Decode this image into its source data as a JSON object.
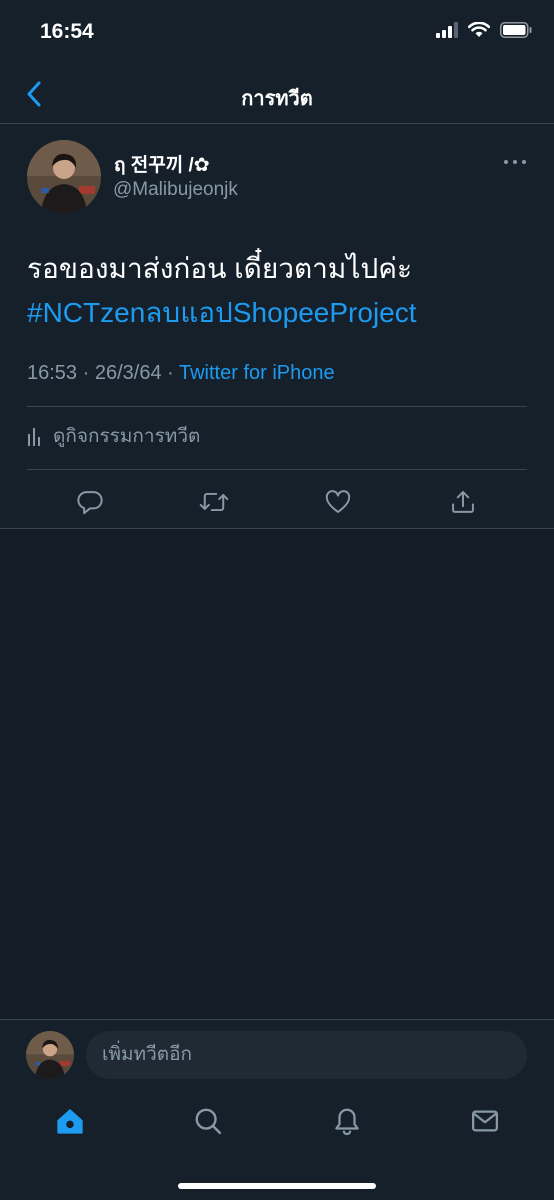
{
  "status_bar": {
    "time": "16:54"
  },
  "header": {
    "title": "การทวีต"
  },
  "tweet": {
    "display_name": "ฤ 전꾸끼 /✿",
    "handle": "@Malibujeonjk",
    "text": "รอของมาส่งก่อน เดี๋ยวตามไปค่ะ",
    "hashtag": "#NCTzenลบแอปShopeeProject",
    "time": "16:53",
    "date": "26/3/64",
    "source": "Twitter for iPhone",
    "activity_label": "ดูกิจกรรมการทวีต"
  },
  "reply": {
    "placeholder": "เพิ่มทวีตอีก"
  },
  "icons": {
    "back": "chevron-left-icon",
    "more": "more-dots-icon",
    "activity": "bar-chart-icon",
    "reply": "reply-icon",
    "retweet": "retweet-icon",
    "like": "heart-icon",
    "share": "share-icon",
    "home": "home-icon",
    "search": "search-icon",
    "notifications": "bell-icon",
    "messages": "mail-icon"
  },
  "colors": {
    "background": "#15202b",
    "accent": "#1d9bf0",
    "muted": "#8899a6",
    "border": "#38444d"
  }
}
